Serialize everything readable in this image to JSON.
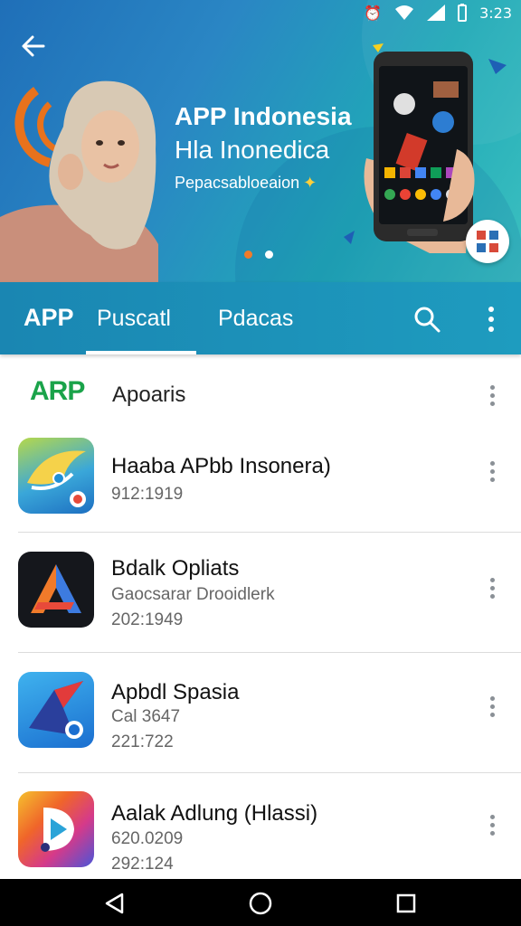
{
  "status": {
    "time": "3:23"
  },
  "hero": {
    "title": "APP Indonesia",
    "subtitle": "Hla Inonedica",
    "tagline": "Pepacsabloeaion"
  },
  "tabs": {
    "brand": "APP",
    "items": [
      "Puscatl",
      "Pdacas"
    ],
    "active_index": 0
  },
  "header": {
    "logo": "ARP",
    "title": "Apoaris"
  },
  "apps": [
    {
      "title": "Haaba APbb Insonera)",
      "lines": [
        "912:1919"
      ],
      "icon": "bird-app-icon"
    },
    {
      "title": "Bdalk Opliats",
      "lines": [
        "Gaocsarar Drooidlerk",
        "202:1949"
      ],
      "icon": "triangle-app-icon"
    },
    {
      "title": "Apbdl Spasia",
      "lines": [
        "Cal 3647",
        "221:722"
      ],
      "icon": "ninja-star-app-icon"
    },
    {
      "title": "Aalak Adlung (Hlassi)",
      "lines": [
        "620.0209",
        "292:124"
      ],
      "icon": "play-app-icon"
    }
  ],
  "colors": {
    "accent": "#1e9cbf",
    "logo_green": "#1aa34a",
    "dot_active": "#f07b2a"
  },
  "icons": [
    "back-arrow-icon",
    "search-icon",
    "overflow-menu-icon",
    "nav-back-icon",
    "nav-home-icon",
    "nav-recents-icon"
  ]
}
